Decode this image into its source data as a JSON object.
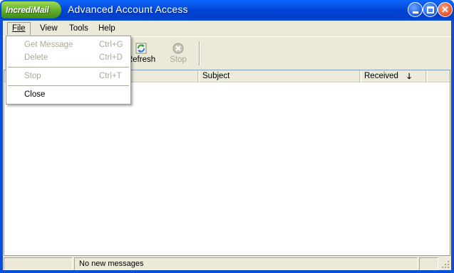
{
  "window": {
    "brand": "IncrediMail",
    "title": "Advanced Account Access"
  },
  "menu": {
    "file": "File",
    "view": "View",
    "tools": "Tools",
    "help": "Help"
  },
  "file_menu": {
    "get_message": {
      "label": "Get Message",
      "shortcut": "Ctrl+G"
    },
    "delete": {
      "label": "Delete",
      "shortcut": "Ctrl+D"
    },
    "stop": {
      "label": "Stop",
      "shortcut": "Ctrl+T"
    },
    "close": {
      "label": "Close"
    }
  },
  "toolbar": {
    "refresh": "Refresh",
    "stop": "Stop"
  },
  "columns": {
    "subject": "Subject",
    "received": "Received"
  },
  "status": {
    "message": "No new messages"
  },
  "colors": {
    "titlebar": "#0046d6",
    "brand_green": "#5ea82a",
    "face": "#ece9d8"
  }
}
